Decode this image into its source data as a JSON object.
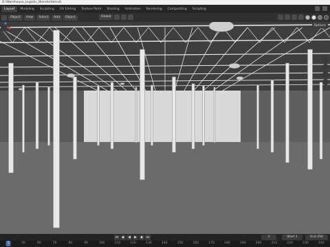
{
  "window": {
    "title": "D:\\Warehouse_Logistic_Blender\\blend\\"
  },
  "workspace_tabs": [
    "Layout",
    "Modeling",
    "Sculpting",
    "UV Editing",
    "Texture Paint",
    "Shading",
    "Animation",
    "Rendering",
    "Compositing",
    "Scripting"
  ],
  "active_tab": "Layout",
  "header": {
    "mode": "Object",
    "view": "View",
    "select": "Select",
    "add": "Add",
    "object": "Object",
    "orientation": "Global"
  },
  "viewport": {
    "options_label": "Options",
    "fill_color": "#6f6f6f",
    "floor_color": "#6b6b6b",
    "steel_color": "#e8e8e8"
  },
  "timeline": {
    "ruler_ticks": [
      "0",
      "50",
      "60",
      "70",
      "80",
      "90",
      "100",
      "110",
      "120",
      "130",
      "140",
      "150",
      "160",
      "170",
      "180",
      "190",
      "200",
      "210",
      "220",
      "230",
      "240",
      "250"
    ],
    "current_frame": "1",
    "start_label": "Start",
    "start_value": "1",
    "end_label": "End",
    "end_value": "250"
  }
}
